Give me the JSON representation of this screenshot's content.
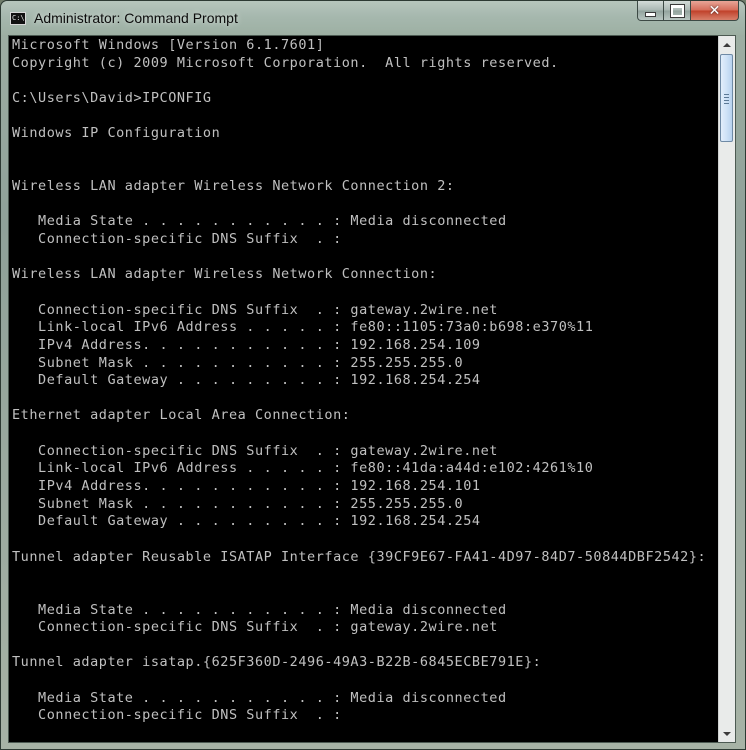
{
  "window": {
    "title": "Administrator: Command Prompt",
    "icon": "cmd-icon",
    "icon_glyph": "C:\\."
  },
  "caption_buttons": {
    "minimize_icon": "minimize-icon",
    "maximize_icon": "maximize-icon",
    "close_icon": "close-icon",
    "close_glyph": "✕"
  },
  "colors": {
    "console_bg": "#000000",
    "console_text": "#c0c0c0",
    "close_button": "#c0412a"
  },
  "console": {
    "lines": [
      "Microsoft Windows [Version 6.1.7601]",
      "Copyright (c) 2009 Microsoft Corporation.  All rights reserved.",
      "",
      "C:\\Users\\David>IPCONFIG",
      "",
      "Windows IP Configuration",
      "",
      "",
      "Wireless LAN adapter Wireless Network Connection 2:",
      "",
      "   Media State . . . . . . . . . . . : Media disconnected",
      "   Connection-specific DNS Suffix  . :",
      "",
      "Wireless LAN adapter Wireless Network Connection:",
      "",
      "   Connection-specific DNS Suffix  . : gateway.2wire.net",
      "   Link-local IPv6 Address . . . . . : fe80::1105:73a0:b698:e370%11",
      "   IPv4 Address. . . . . . . . . . . : 192.168.254.109",
      "   Subnet Mask . . . . . . . . . . . : 255.255.255.0",
      "   Default Gateway . . . . . . . . . : 192.168.254.254",
      "",
      "Ethernet adapter Local Area Connection:",
      "",
      "   Connection-specific DNS Suffix  . : gateway.2wire.net",
      "   Link-local IPv6 Address . . . . . : fe80::41da:a44d:e102:4261%10",
      "   IPv4 Address. . . . . . . . . . . : 192.168.254.101",
      "   Subnet Mask . . . . . . . . . . . : 255.255.255.0",
      "   Default Gateway . . . . . . . . . : 192.168.254.254",
      "",
      "Tunnel adapter Reusable ISATAP Interface {39CF9E67-FA41-4D97-84D7-50844DBF2542}:",
      "",
      "",
      "   Media State . . . . . . . . . . . : Media disconnected",
      "   Connection-specific DNS Suffix  . : gateway.2wire.net",
      "",
      "Tunnel adapter isatap.{625F360D-2496-49A3-B22B-6845ECBE791E}:",
      "",
      "   Media State . . . . . . . . . . . : Media disconnected",
      "   Connection-specific DNS Suffix  . :",
      ""
    ]
  },
  "scrollbar": {
    "up_icon": "scroll-up-arrow-icon",
    "down_icon": "scroll-down-arrow-icon",
    "position": 0.0
  }
}
